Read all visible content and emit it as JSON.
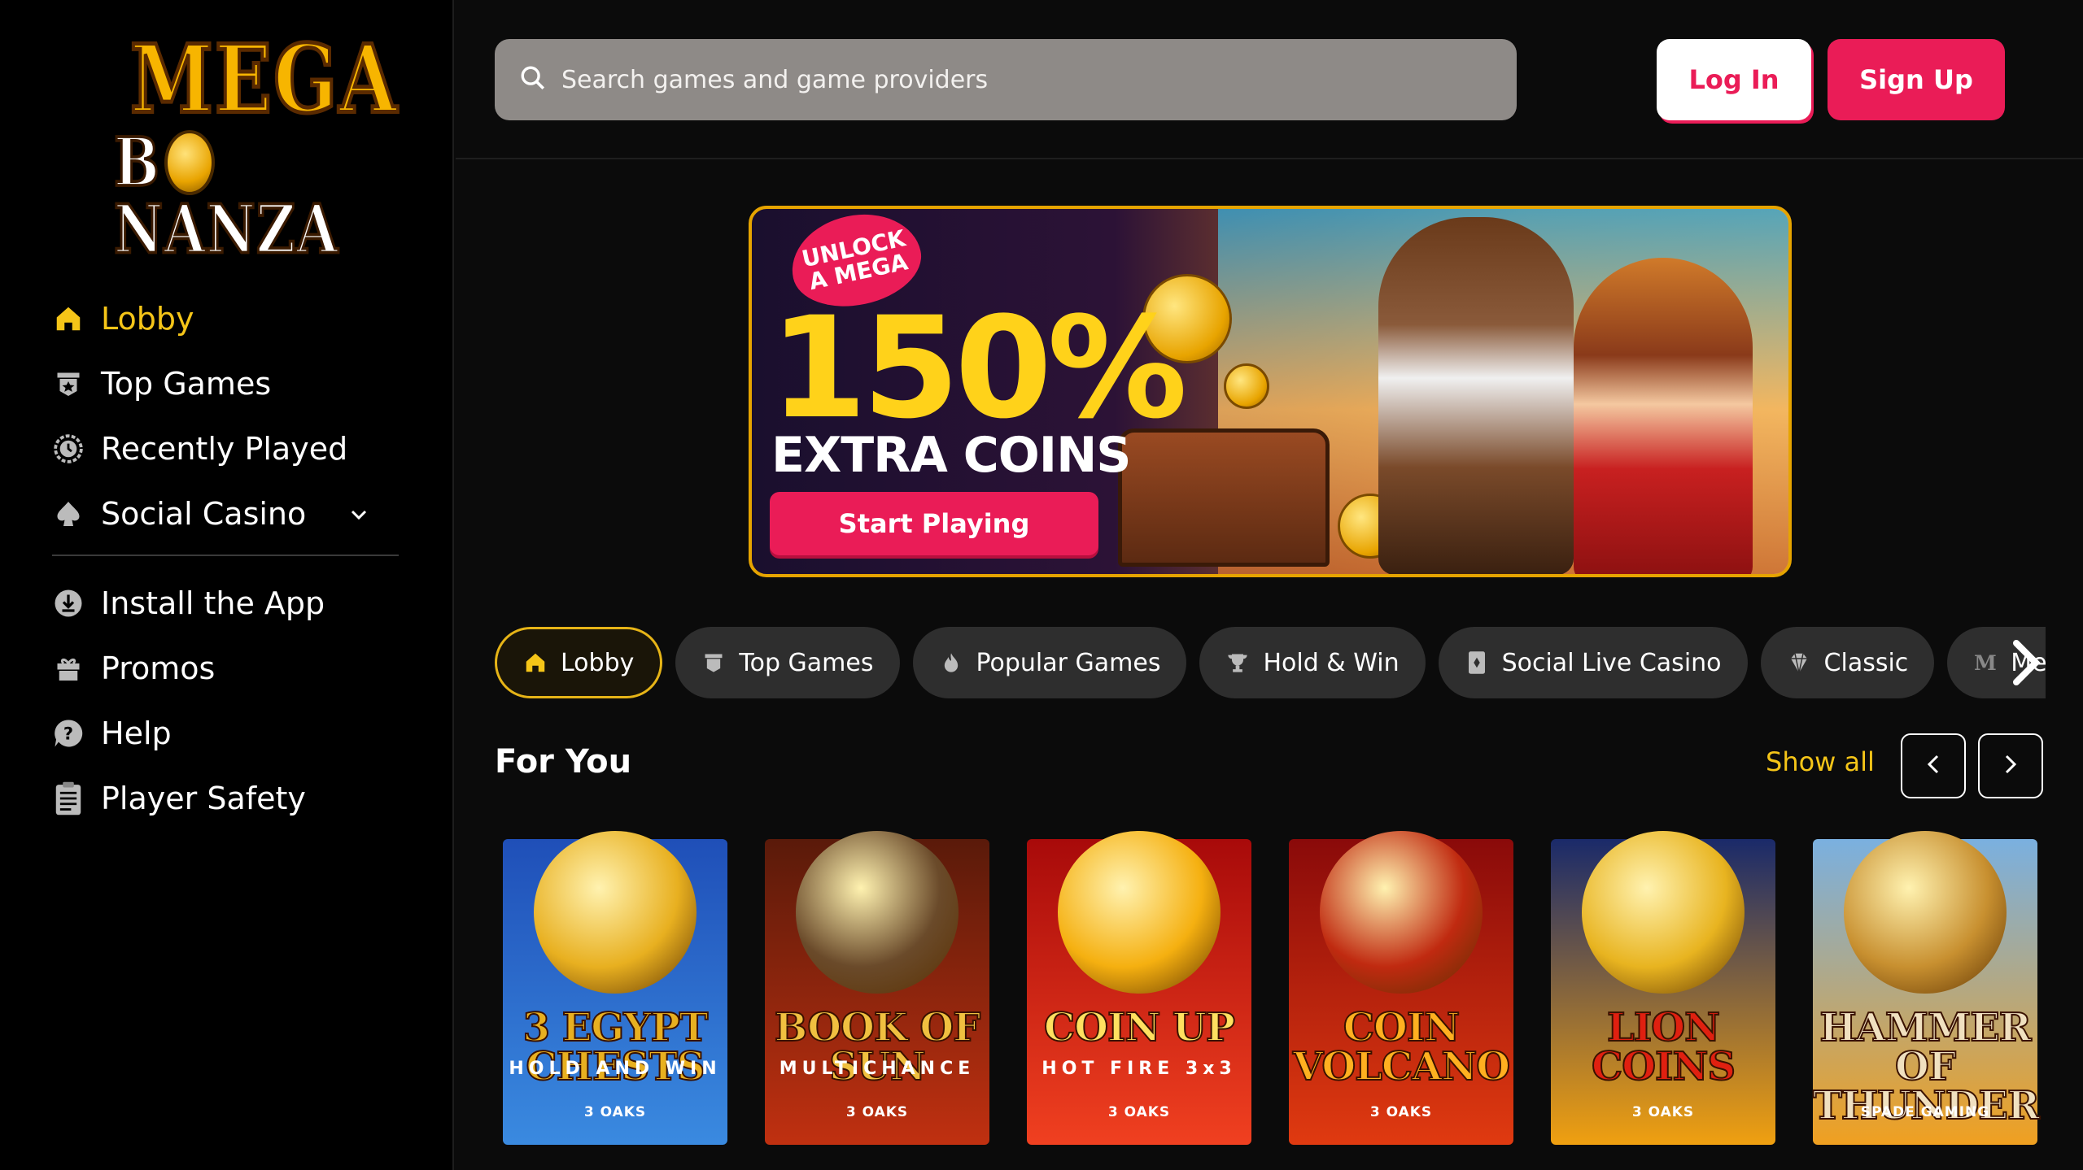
{
  "brand": {
    "logo_line1": "MEGA",
    "logo_line2": "B NANZA"
  },
  "sidebar": {
    "items": [
      {
        "label": "Lobby",
        "icon": "home-icon",
        "active": true
      },
      {
        "label": "Top Games",
        "icon": "top-games-icon"
      },
      {
        "label": "Recently Played",
        "icon": "clock-icon"
      },
      {
        "label": "Social Casino",
        "icon": "spade-icon",
        "expandable": true
      }
    ],
    "secondary": [
      {
        "label": "Install the App",
        "icon": "download-icon"
      },
      {
        "label": "Promos",
        "icon": "gift-icon"
      },
      {
        "label": "Help",
        "icon": "help-icon"
      },
      {
        "label": "Player Safety",
        "icon": "clipboard-icon"
      }
    ]
  },
  "header": {
    "search_placeholder": "Search games and game providers",
    "login_label": "Log In",
    "signup_label": "Sign Up"
  },
  "banner": {
    "tag_line1": "UNLOCK",
    "tag_line2": "A MEGA",
    "headline": "150%",
    "subline": "EXTRA COINS",
    "cta_label": "Start Playing"
  },
  "categories": [
    {
      "label": "Lobby",
      "icon": "home-icon",
      "active": true
    },
    {
      "label": "Top Games",
      "icon": "top-games-icon"
    },
    {
      "label": "Popular Games",
      "icon": "flame-icon"
    },
    {
      "label": "Hold & Win",
      "icon": "trophy-icon"
    },
    {
      "label": "Social Live Casino",
      "icon": "card-icon"
    },
    {
      "label": "Classic",
      "icon": "diamond-icon"
    },
    {
      "label": "Mega",
      "icon": "m-icon"
    }
  ],
  "section": {
    "title": "For You",
    "show_all": "Show all"
  },
  "games": [
    {
      "title": "3 EGYPT CHESTS",
      "subtitle": "HOLD AND WIN",
      "provider": "3 OAKS",
      "bg": "#1f4fb8",
      "bg2": "#3a8ae0",
      "art": "#e8b020",
      "title_color": "#e8b020"
    },
    {
      "title": "BOOK OF SUN",
      "subtitle": "MULTICHANCE",
      "provider": "3 OAKS",
      "bg": "#5a1a0a",
      "bg2": "#c03010",
      "art": "#6a4a2a",
      "title_color": "#f0c040"
    },
    {
      "title": "COIN UP",
      "subtitle": "HOT FIRE 3x3",
      "provider": "3 OAKS",
      "bg": "#a80a0a",
      "bg2": "#f04020",
      "art": "#f5b010",
      "title_color": "#ffe060"
    },
    {
      "title": "COIN VOLCANO",
      "subtitle": "",
      "provider": "3 OAKS",
      "bg": "#8a0a0a",
      "bg2": "#e03a10",
      "art": "#c02a10",
      "title_color": "#ffb020"
    },
    {
      "title": "LION COINS",
      "subtitle": "",
      "provider": "3 OAKS",
      "bg": "#1a2a6a",
      "bg2": "#f0a010",
      "art": "#e8b420",
      "title_color": "#e02010"
    },
    {
      "title": "HAMMER OF THUNDER",
      "subtitle": "",
      "provider": "SPADE GAMING",
      "bg": "#7ab0e0",
      "bg2": "#f0a020",
      "art": "#c89030",
      "title_color": "#f0e0c0"
    }
  ]
}
